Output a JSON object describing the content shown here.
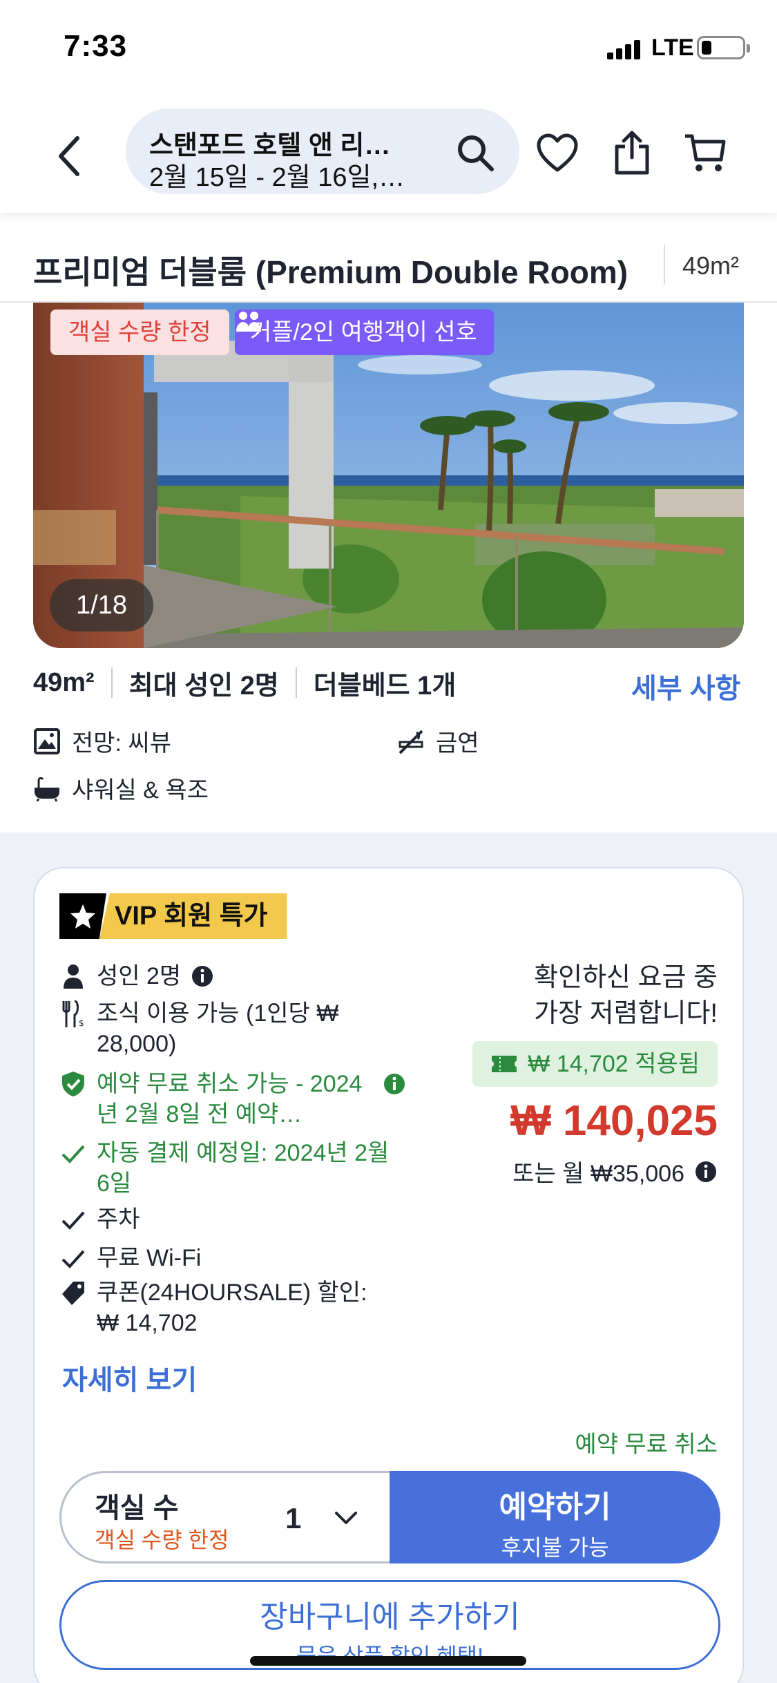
{
  "status_bar": {
    "time": "7:33",
    "network": "LTE"
  },
  "header": {
    "hotel_name": "스탠포드 호텔 앤 리…",
    "dates": "2월 15일 - 2월 16일,…"
  },
  "room": {
    "title": "프리미엄 더블룸 (Premium Double Room)",
    "size": "49m²",
    "badges": {
      "limited": "객실 수량 한정",
      "couple": "커플/2인 여행객이 선호"
    },
    "photo_counter": "1/18",
    "facts": [
      "49m²",
      "최대 성인 2명",
      "더블베드 1개"
    ],
    "details_link": "세부 사항",
    "amenities": {
      "view": "전망: 씨뷰",
      "smoking": "금연",
      "bath": "샤워실 & 욕조"
    }
  },
  "offer": {
    "vip_label": "VIP 회원 특가",
    "features": {
      "adults": "성인 2명",
      "breakfast": "조식 이용 가능 (1인당 ₩ 28,000)",
      "cancel": "예약 무료 취소 가능 - 2024년 2월 8일 전 예약…",
      "autopay": "자동 결제 예정일: 2024년 2월 6일",
      "parking": "주차",
      "wifi": "무료 Wi-Fi",
      "coupon": "쿠폰(24HOURSALE) 할인: ₩ 14,702"
    },
    "cheapest_line1": "확인하신 요금 중",
    "cheapest_line2": "가장 저렴합니다!",
    "applied": "₩ 14,702 적용됨",
    "price": "₩ 140,025",
    "monthly": "또는 월 ₩35,006",
    "more_link": "자세히 보기",
    "free_cancel": "예약 무료 취소",
    "rooms_label": "객실 수",
    "rooms_sub": "객실 수량 한정",
    "rooms_qty": "1",
    "book_main": "예약하기",
    "book_sub": "후지불 가능",
    "cart_main": "장바구니에 추가하기",
    "cart_sub": "묶음 상품 할인 혜택!"
  },
  "colors": {
    "accent_blue": "#3c6fd6",
    "price_red": "#d23a2e",
    "green": "#2a8a3e",
    "vip_yellow": "#f2c94c",
    "couple_purple": "#7a5af8"
  },
  "icons": {
    "header": [
      "back-chevron-icon",
      "search-icon",
      "heart-icon",
      "share-icon",
      "cart-icon"
    ],
    "amenities": [
      "sea-view-icon",
      "no-smoking-icon",
      "bathtub-icon"
    ],
    "offer": [
      "star-icon",
      "person-icon",
      "cutlery-icon",
      "shield-check-icon",
      "check-icon",
      "tag-icon",
      "ticket-icon",
      "info-icon"
    ]
  }
}
